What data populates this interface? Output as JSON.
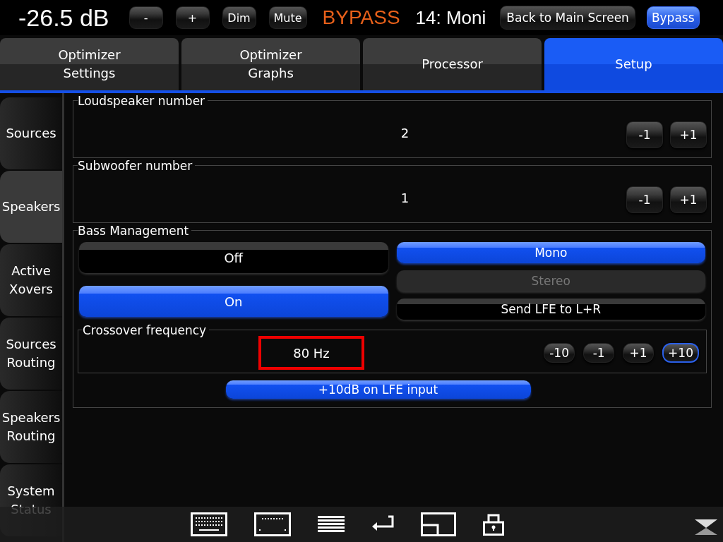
{
  "top_bar": {
    "level": "-26.5 dB",
    "buttons": [
      "-",
      "+",
      "Dim",
      "Mute"
    ],
    "status": "BYPASS",
    "preset": "14: Moni",
    "back_button": "Back to Main Screen",
    "bypass_button": {
      "label": "Bypass",
      "selected": true
    }
  },
  "tabs": [
    {
      "label": "Optimizer\nSettings",
      "selected": false
    },
    {
      "label": "Optimizer\nGraphs",
      "selected": false
    },
    {
      "label": "Processor",
      "selected": false
    },
    {
      "label": "Setup",
      "selected": true
    }
  ],
  "sidebar": {
    "items": [
      {
        "label": "Sources",
        "selected": false
      },
      {
        "label": "Speakers",
        "selected": true
      },
      {
        "label": "Active\nXovers",
        "selected": false
      },
      {
        "label": "Sources\nRouting",
        "selected": false
      },
      {
        "label": "Speakers\nRouting",
        "selected": false
      },
      {
        "label": "System\nStatus",
        "selected": false
      }
    ]
  },
  "counters": [
    {
      "title": "Loudspeaker number",
      "value": "2",
      "buttons": [
        "-1",
        "+1"
      ]
    },
    {
      "title": "Subwoofer number",
      "value": "1",
      "buttons": [
        "-1",
        "+1"
      ]
    }
  ],
  "bass_management": {
    "title": "Bass Management",
    "mode_options": [
      {
        "label": "Off",
        "selected": false
      },
      {
        "label": "On",
        "selected": true
      }
    ],
    "output_options": [
      {
        "label": "Mono",
        "selected": true,
        "disabled": false
      },
      {
        "label": "Stereo",
        "selected": false,
        "disabled": true
      },
      {
        "label": "Send LFE to L+R",
        "selected": false,
        "disabled": false
      }
    ],
    "crossover": {
      "title": "Crossover frequency",
      "value": "80 Hz",
      "highlighted": true,
      "steps": [
        {
          "label": "-10",
          "selected": false
        },
        {
          "label": "-1",
          "selected": false
        },
        {
          "label": "+1",
          "selected": false
        },
        {
          "label": "+10",
          "selected": true
        }
      ]
    },
    "lfe_boost": {
      "label": "+10dB on LFE input",
      "selected": true
    }
  }
}
